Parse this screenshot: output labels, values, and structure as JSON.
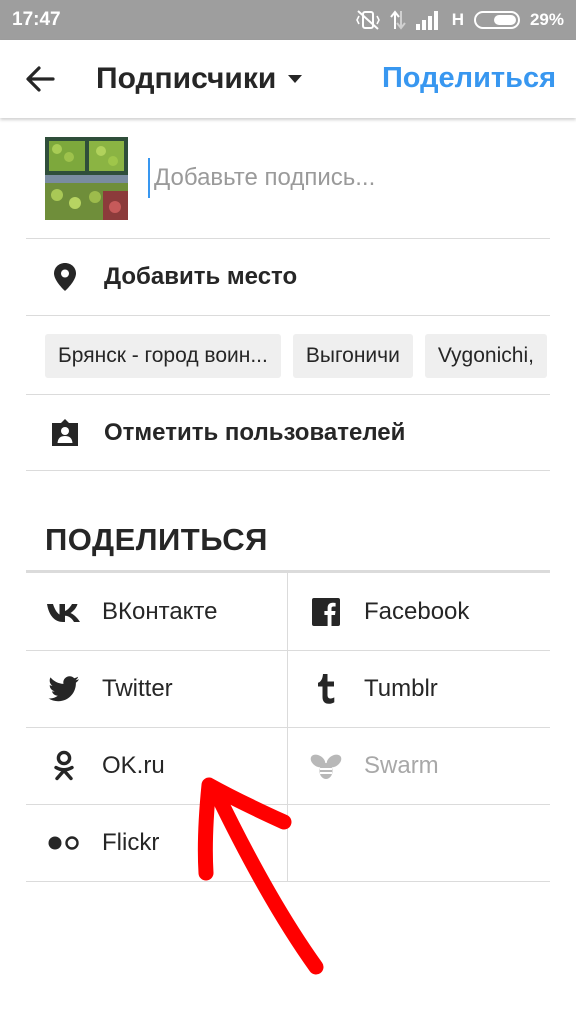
{
  "status_bar": {
    "time": "17:47",
    "network": "H",
    "battery": "29%"
  },
  "app_bar": {
    "title": "Подписчики",
    "share_label": "Поделиться"
  },
  "caption": {
    "placeholder": "Добавьте подпись..."
  },
  "add_location": {
    "label": "Добавить место"
  },
  "location_suggestions": [
    "Брянск - город воин...",
    "Выгоничи",
    "Vygonichi,"
  ],
  "tag_people": {
    "label": "Отметить пользователей"
  },
  "share_section": {
    "title": "ПОДЕЛИТЬСЯ",
    "items": [
      {
        "label": "ВКонтакте",
        "icon": "vk-icon",
        "enabled": true
      },
      {
        "label": "Facebook",
        "icon": "facebook-icon",
        "enabled": true
      },
      {
        "label": "Twitter",
        "icon": "twitter-icon",
        "enabled": true
      },
      {
        "label": "Tumblr",
        "icon": "tumblr-icon",
        "enabled": true
      },
      {
        "label": "OK.ru",
        "icon": "ok-icon",
        "enabled": true
      },
      {
        "label": "Swarm",
        "icon": "swarm-icon",
        "enabled": false
      },
      {
        "label": "Flickr",
        "icon": "flickr-icon",
        "enabled": true
      }
    ]
  },
  "colors": {
    "accent": "#3897f0",
    "annotation_arrow": "#ff0000",
    "disabled_text": "#a8a8a8"
  }
}
